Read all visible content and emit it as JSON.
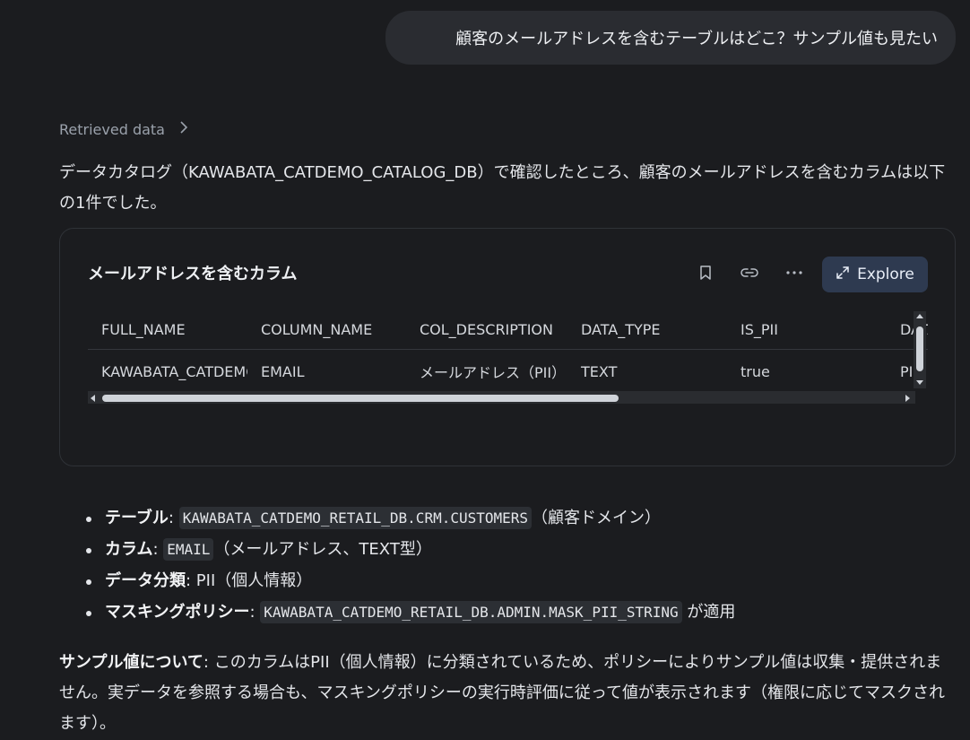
{
  "user_message": "顧客のメールアドレスを含むテーブルはどこ？サンプル値も見たい",
  "retrieved_label": "Retrieved data",
  "intro_text": "データカタログ（KAWABATA_CATDEMO_CATALOG_DB）で確認したところ、顧客のメールアドレスを含むカラムは以下の1件でした。",
  "card": {
    "title": "メールアドレスを含むカラム",
    "explore_label": "Explore",
    "columns": [
      "FULL_NAME",
      "COLUMN_NAME",
      "COL_DESCRIPTION",
      "DATA_TYPE",
      "IS_PII",
      "DATA_CLASS"
    ],
    "rows": [
      [
        "KAWABATA_CATDEMO_RETAIL_DB.CRM.CUSTOMERS.EMAIL",
        "EMAIL",
        "メールアドレス（PII）",
        "TEXT",
        "true",
        "PII"
      ]
    ]
  },
  "bullets": [
    {
      "label": "テーブル",
      "sep": ": ",
      "code": "KAWABATA_CATDEMO_RETAIL_DB.CRM.CUSTOMERS",
      "after": "（顧客ドメイン）"
    },
    {
      "label": "カラム",
      "sep": ": ",
      "code": "EMAIL",
      "after": "（メールアドレス、TEXT型）"
    },
    {
      "label": "データ分類",
      "sep": ": PII（個人情報）",
      "code": "",
      "after": ""
    },
    {
      "label": "マスキングポリシー",
      "sep": ": ",
      "code": "KAWABATA_CATDEMO_RETAIL_DB.ADMIN.MASK_PII_STRING",
      "after": " が適用"
    }
  ],
  "sample_note": {
    "label": "サンプル値について",
    "text": ": このカラムはPII（個人情報）に分類されているため、ポリシーによりサンプル値は収集・提供されません。実データを参照する場合も、マスキングポリシーの実行時評価に従って値が表示されます（権限に応じてマスクされます）。"
  },
  "icons": [
    "bookmark-icon",
    "link-icon",
    "more-icon",
    "expand-icon",
    "chevron-right-icon"
  ]
}
